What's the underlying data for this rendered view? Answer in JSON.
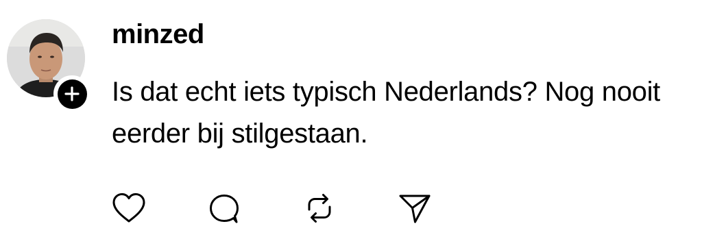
{
  "post": {
    "username": "minzed",
    "text": "Is dat echt iets typisch Nederlands? Nog nooit eerder bij stilgestaan.",
    "avatar_icon": "profile-photo",
    "follow_icon": "plus-icon",
    "actions": [
      {
        "icon": "heart-icon"
      },
      {
        "icon": "comment-icon"
      },
      {
        "icon": "repost-icon"
      },
      {
        "icon": "share-icon"
      }
    ]
  },
  "colors": {
    "text": "#000000",
    "background": "#ffffff",
    "icon_stroke": "#000000"
  }
}
